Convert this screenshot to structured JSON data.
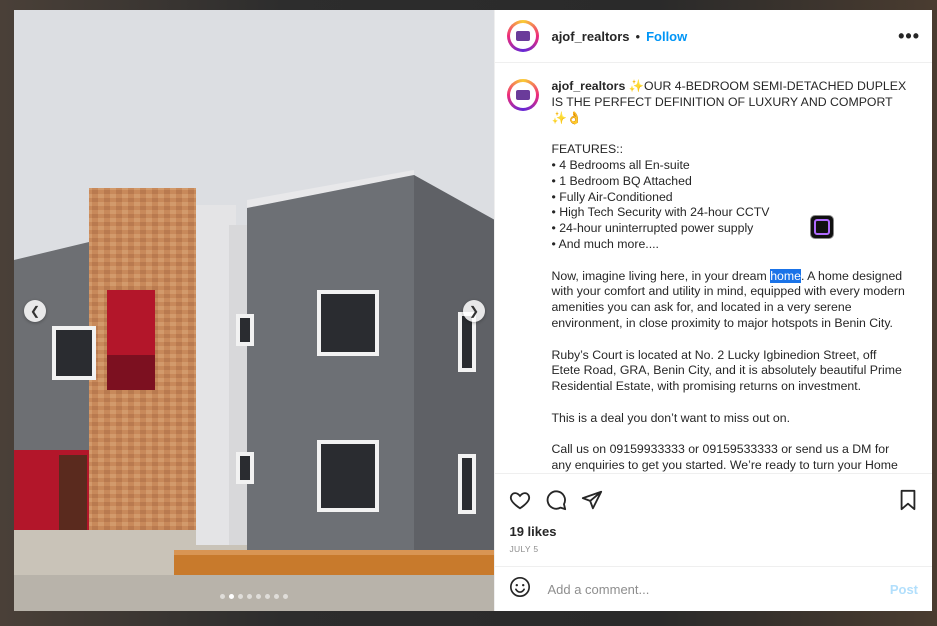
{
  "post": {
    "username": "ajof_realtors",
    "separator": "•",
    "follow_label": "Follow",
    "more_label": "•••",
    "caption": {
      "username": "ajof_realtors",
      "line1": "✨OUR 4-BEDROOM SEMI-DETACHED DUPLEX IS THE PERFECT DEFINITION OF LUXURY AND COMPORT ✨👌",
      "features_title": "FEATURES::",
      "features": [
        "• 4 Bedrooms all En-suite",
        "• 1 Bedroom BQ Attached",
        "• Fully Air-Conditioned",
        "• High Tech Security with 24-hour CCTV",
        "• 24-hour uninterrupted power supply",
        "• And much more...."
      ],
      "para2_before": "Now, imagine living here, in your dream ",
      "para2_highlight": "home",
      "para2_after": ". A home designed with your comfort and utility in mind, equipped with every modern amenities you can ask for, and located in a very serene environment, in close proximity to major hotspots in Benin City.",
      "para3": "Ruby’s Court is located at No. 2 Lucky Igbinedion Street, off Etete Road, GRA, Benin City, and it is absolutely beautiful Prime Residential Estate, with promising returns on investment.",
      "para4": "This is a deal you don’t want to miss out on.",
      "para5": "Call us on 09159933333 or 09159533333 or send us a DM for any enquiries to get you started. We’re ready to turn your Home Ownership dreams into reality.👌😊"
    },
    "likes": "19 likes",
    "date": "JULY 5",
    "comment_placeholder": "Add a comment...",
    "post_label": "Post",
    "carousel": {
      "total": 8,
      "active_index": 1
    }
  },
  "icons": {
    "prev": "chevron-left-icon",
    "next": "chevron-right-icon",
    "like": "heart-icon",
    "comment": "comment-icon",
    "share": "send-icon",
    "save": "bookmark-icon",
    "emoji": "emoji-icon"
  },
  "colors": {
    "accent": "#0095f6",
    "highlight": "#1a73e8",
    "text": "#262626",
    "muted": "#8e8e8e"
  }
}
